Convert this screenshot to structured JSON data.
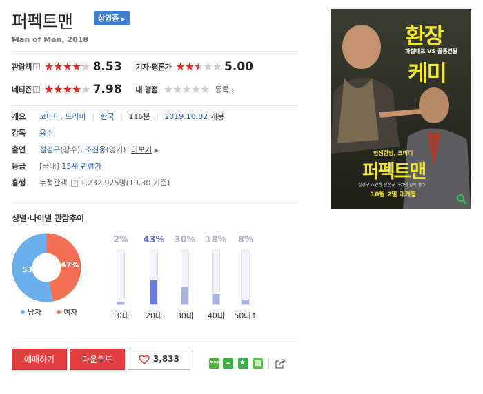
{
  "movie": {
    "title": "퍼펙트맨",
    "status_badge": "상영중",
    "subtitle": "Man of Men, 2018"
  },
  "ratings": {
    "audience": {
      "label": "관람객",
      "score": "8.53",
      "stars": 4.3
    },
    "critics": {
      "label": "기자·평론가",
      "score": "5.00",
      "stars": 2.5
    },
    "netizen": {
      "label": "네티즌",
      "score": "7.98",
      "stars": 4.0
    },
    "mine": {
      "label": "내 평점",
      "register": "등록",
      "stars": 0
    }
  },
  "info": {
    "overview_label": "개요",
    "genre1": "코미디",
    "genre_sep": ", ",
    "genre2": "드라마",
    "country": "한국",
    "runtime": "116분",
    "release_date": "2019.10.02",
    "release_suffix": "개봉",
    "director_label": "감독",
    "director": "용수",
    "cast_label": "출연",
    "actor1": "설경구",
    "actor1_role": "(장수)",
    "cast_sep": ", ",
    "actor2": "조진웅",
    "actor2_role": "(영기)",
    "more": "더보기",
    "grade_label": "등급",
    "grade_region": "[국내]",
    "grade": "15세 관람가",
    "boxoffice_label": "흥행",
    "boxoffice_prefix": "누적관객",
    "boxoffice_value": "1,232,925명",
    "boxoffice_date": "(10.30 기준)"
  },
  "poster": {
    "headline1": "환장",
    "headline2": "케미",
    "tagline": "까칠대표 VS 꼴통건달",
    "genre_tag": "인생한방, 코미디",
    "title": "퍼펙트맨",
    "release": "10월 2일 대개봉",
    "credits": "설경구  조진웅  진선규  허성태  감독 용수"
  },
  "demographics": {
    "section_title": "성별·나이별 관람추이",
    "gender": [
      {
        "label": "남자",
        "percent": 53,
        "percent_text": "53%",
        "color": "#6aaeea"
      },
      {
        "label": "여자",
        "percent": 47,
        "percent_text": "47%",
        "color": "#f46f54"
      }
    ],
    "ages": [
      {
        "label": "10대",
        "percent": 2,
        "percent_text": "2%"
      },
      {
        "label": "20대",
        "percent": 43,
        "percent_text": "43%"
      },
      {
        "label": "30대",
        "percent": 30,
        "percent_text": "30%"
      },
      {
        "label": "40대",
        "percent": 18,
        "percent_text": "18%"
      },
      {
        "label": "50대↑",
        "percent": 8,
        "percent_text": "8%"
      }
    ]
  },
  "actions": {
    "book": "예매하기",
    "download": "다운로드",
    "likes": "3,833"
  },
  "share": {
    "blog_label": "blog"
  }
}
